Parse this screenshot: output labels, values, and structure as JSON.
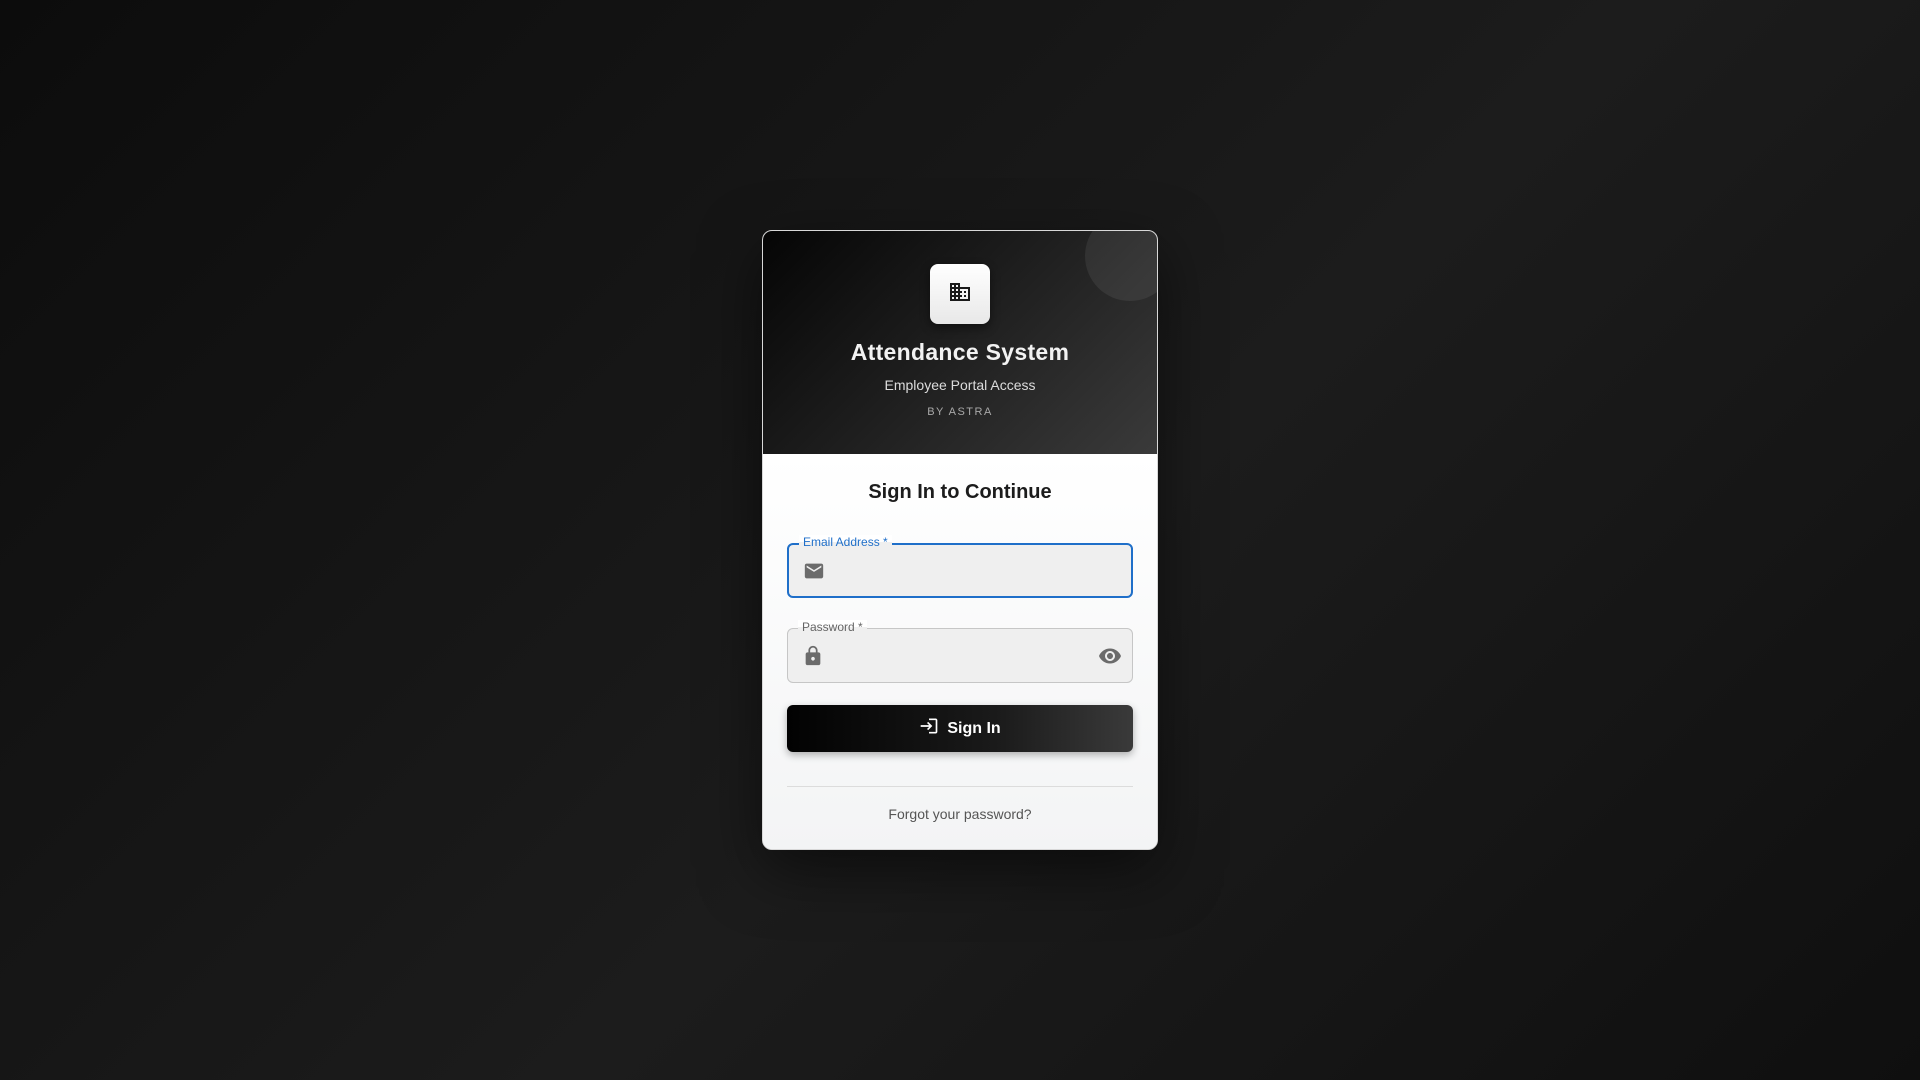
{
  "app": {
    "title": "Attendance System",
    "subtitle": "Employee Portal Access",
    "brand": "BY ASTRA",
    "logo_icon": "building-icon"
  },
  "form": {
    "title": "Sign In to Continue",
    "email": {
      "label": "Email Address *",
      "value": "",
      "icon": "mail-icon"
    },
    "password": {
      "label": "Password *",
      "value": "",
      "icon": "lock-icon",
      "toggle_icon": "eye-icon"
    },
    "submit_label": "Sign In",
    "submit_icon": "login-icon",
    "forgot_label": "Forgot your password?"
  },
  "colors": {
    "accent": "#1f6fc9",
    "background": "#141414",
    "button": "#0a0a0a",
    "card": "#ffffff"
  }
}
